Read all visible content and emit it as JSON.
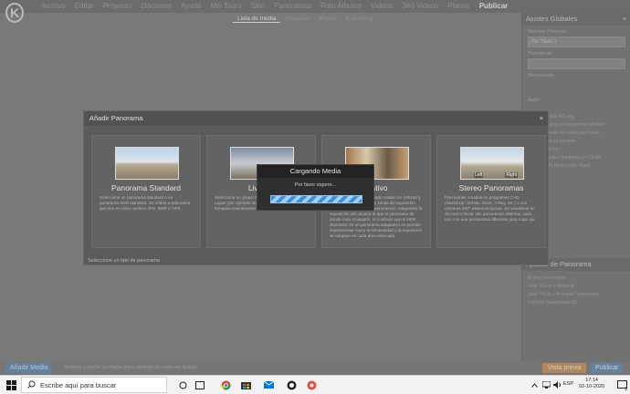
{
  "menu": [
    "Archivo",
    "Editar",
    "Proyecto",
    "Opciones",
    "Ayuda",
    "Mis Tours",
    "Skin",
    "Panoramas",
    "Foto Álbums",
    "Videos",
    "360 Videos",
    "Planos",
    "Publicar"
  ],
  "subtabs": [
    "Lista de media",
    "Etiquetas",
    "Mapas",
    "E-learning"
  ],
  "right_panel": {
    "global_title": "Ajustes Globales",
    "project_name_label": "Nombre Proyecto",
    "project_name_value": "Sin Título 1",
    "thumbnail_label": "Thumbnail",
    "description_label": "Descripción",
    "author_label": "Autor",
    "options": [
      "Mostrar Tooltip 0.8 seg",
      "Mostrar Tooltip en Recorridos Móviles",
      "Ocultar mando del ratón para touch",
      "Volar Carga en paralelo",
      "Cargas al inicio",
      "Iniciar Pantalla Completa con Clicks",
      "Agregar con Media Little Panel"
    ],
    "panorama_title": "Ajustes de Panorama",
    "panorama_options": [
      "Activar Giroscopio",
      "Usar \"Clicar y Arrastrar\"",
      "Usar \"Tocar y Arrastrar\" para mover",
      "Habilitar Sensibilidad 30"
    ]
  },
  "bottombar": {
    "add_media": "Añadir Media",
    "hint": "Arrastre y suelte un Media para cambiar su orden en la lista",
    "preview": "Vista previa",
    "publish": "Publicar"
  },
  "dialog": {
    "title": "Añadir Panorama",
    "close": "×",
    "footer": "Seleccione un tipo de panorama",
    "cards": [
      {
        "title": "Panorama Standard",
        "thumb": "exterior-panorama",
        "desc": "Seleccione un panorama standard o un panorama HDR standard. Se refiere a panorama que son en único archivo JPG, BMP o TIFF."
      },
      {
        "title": "Live Pa",
        "thumb": "night-panorama",
        "desc": "Seleccione un grupo de distintas horas para crear Lapse (por ejemplo de día deben haber sido tomados exactamente desde el mismo punto."
      },
      {
        "title": "ptativo",
        "thumb": "interior-panorama",
        "desc": "Panorama HDR que ha sido creado en Stitcher y HDR Standard donde las zonas de exposición óptimos con fijos en los panoramas. Adaptando la exposición del usuario al que el panorama de donde mira el usuario. Al contrario que el HDR Standard, en un panorama adaptativo es permite experimentar como la luminosidad y la exposición se adaptan en cada área enfocada."
      },
      {
        "title": "Stereo Panoramas",
        "thumb": "stereo-panorama",
        "desc": "Panoramas creados en programas CAD (SketchUp, 3DMax, Revit, V-Ray, etc.) o con cámaras 360º estereoscópicas. Se visualizan en 3D real al llevar dos panoramas distintos, cada uno con una perspectiva diferente para cada ojo.",
        "left": "Left",
        "right": "Right"
      }
    ]
  },
  "loading": {
    "title": "Cargando Media",
    "message": "Por favor espere...",
    "progress": 1.0
  },
  "taskbar": {
    "search_placeholder": "Escribe aquí para buscar",
    "lang": "ESP",
    "time": "17:14",
    "date": "02-10-2020",
    "notifications": "2",
    "icons": [
      "windows-start-icon",
      "search-icon",
      "task-view-icon",
      "file-explorer-icon",
      "chrome-icon",
      "store-icon",
      "mail-icon",
      "app-icon",
      "3dvista-icon"
    ]
  }
}
